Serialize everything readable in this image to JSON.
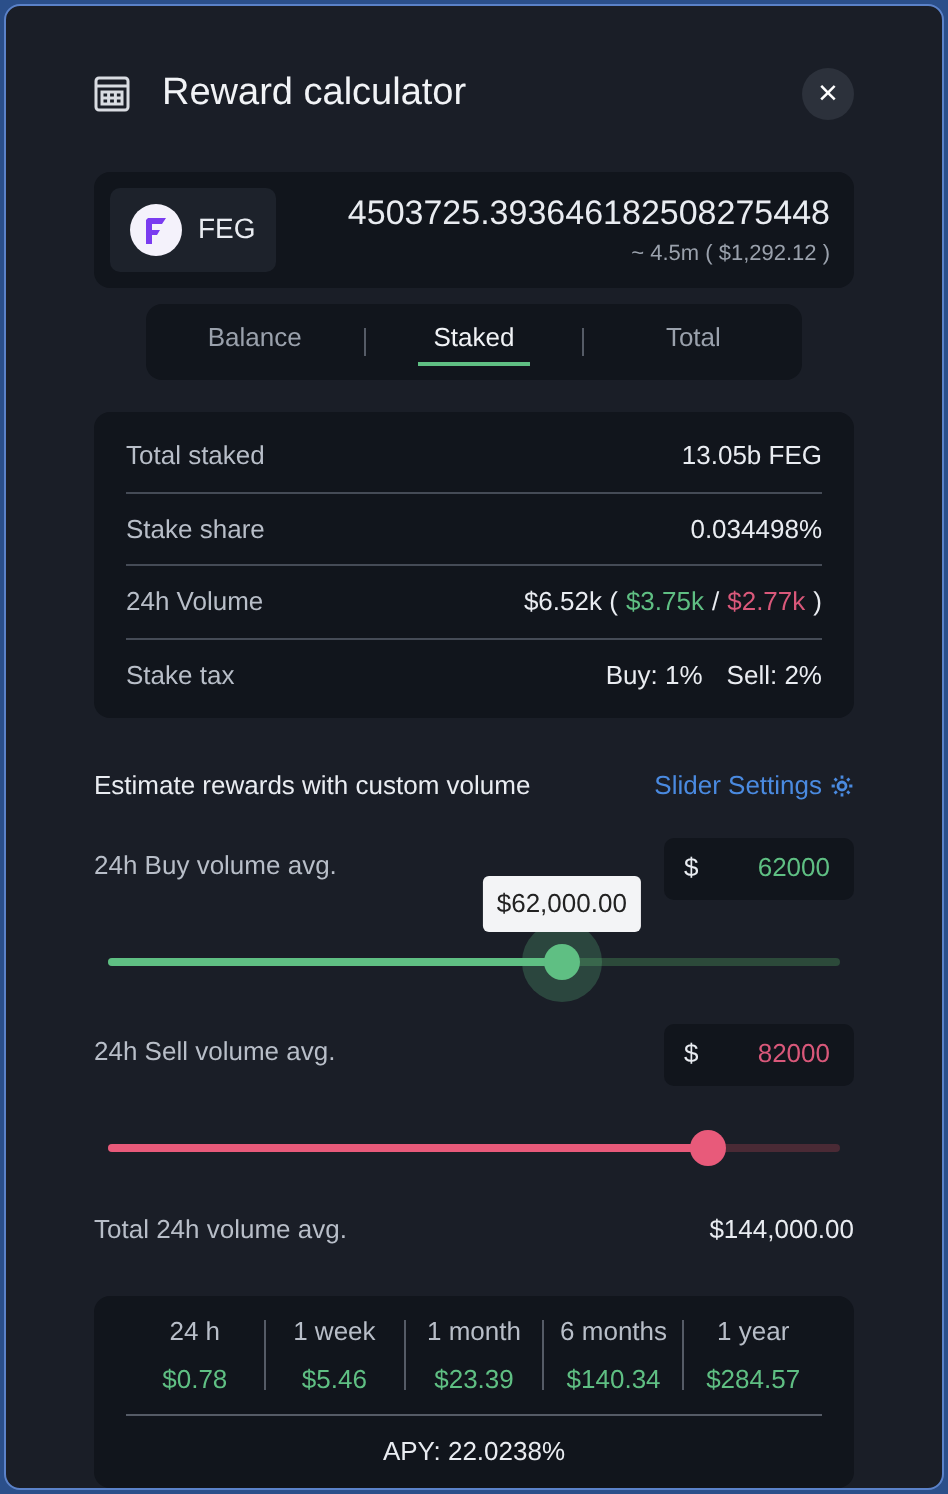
{
  "dialog": {
    "title": "Reward calculator",
    "close_label": "×"
  },
  "token": {
    "symbol": "FEG",
    "amount": "4503725.393646182508275448",
    "approx": "~ 4.5m ( $1,292.12 )"
  },
  "tabs": [
    {
      "label": "Balance",
      "selected": false
    },
    {
      "label": "Staked",
      "selected": true
    },
    {
      "label": "Total",
      "selected": false
    }
  ],
  "stats": [
    {
      "label": "Total staked",
      "parts": [
        {
          "text": "13.05b FEG",
          "kind": "plain"
        }
      ]
    },
    {
      "label": "Stake share",
      "parts": [
        {
          "text": "0.034498%",
          "kind": "plain"
        }
      ]
    },
    {
      "label": "24h Volume",
      "parts": [
        {
          "text": "$6.52k (",
          "kind": "plain"
        },
        {
          "text": "$3.75k",
          "kind": "buy"
        },
        {
          "text": "/",
          "kind": "plain"
        },
        {
          "text": "$2.77k",
          "kind": "sell"
        },
        {
          "text": ")",
          "kind": "plain"
        }
      ]
    },
    {
      "label": "Stake tax",
      "parts": [
        {
          "text": "Buy: 1%",
          "kind": "plain"
        },
        {
          "text": "Sell: 2%",
          "kind": "plain"
        }
      ]
    }
  ],
  "estimate": {
    "title": "Estimate rewards with custom volume",
    "settings_link": "Slider Settings"
  },
  "sliders": [
    {
      "name": "24h Buy volume avg.",
      "currency": "$",
      "value": "62000",
      "kind": "buy",
      "level": 0.62,
      "tooltip": "$62,000.00"
    },
    {
      "name": "24h Sell volume avg.",
      "currency": "$",
      "value": "82000",
      "kind": "sell",
      "level": 0.82
    }
  ],
  "total": {
    "label": "Total 24h volume avg.",
    "value": "$144,000.00"
  },
  "periods": [
    {
      "label": "24 h",
      "value": "$0.78"
    },
    {
      "label": "1 week",
      "value": "$5.46"
    },
    {
      "label": "1 month",
      "value": "$23.39"
    },
    {
      "label": "6 months",
      "value": "$140.34"
    },
    {
      "label": "1 year",
      "value": "$284.57"
    }
  ],
  "apy": "APY: 22.0238%"
}
